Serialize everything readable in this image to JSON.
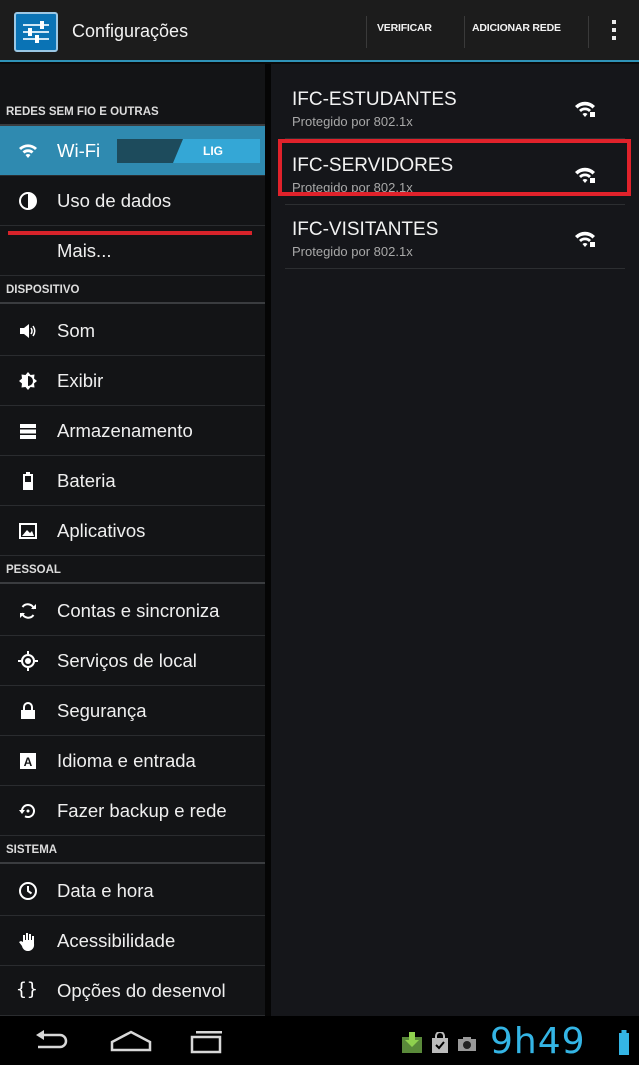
{
  "app": {
    "title": "Configurações",
    "icon": "settings-sliders-icon"
  },
  "actionbar": {
    "verify_label": "VERIFICAR",
    "add_network_label": "ADICIONAR REDE",
    "overflow_icon": "overflow-menu-icon"
  },
  "sidebar": {
    "sections": [
      {
        "header": "REDES SEM FIO E OUTRAS",
        "items": [
          {
            "label": "Wi-Fi",
            "icon": "wifi-icon",
            "active": true,
            "toggle": "LIG"
          },
          {
            "label": "Uso de dados",
            "icon": "data-usage-icon"
          },
          {
            "label": "Mais...",
            "icon": ""
          }
        ]
      },
      {
        "header": "DISPOSITIVO",
        "items": [
          {
            "label": "Som",
            "icon": "speaker-icon"
          },
          {
            "label": "Exibir",
            "icon": "brightness-icon"
          },
          {
            "label": "Armazenamento",
            "icon": "storage-icon"
          },
          {
            "label": "Bateria",
            "icon": "battery-icon"
          },
          {
            "label": "Aplicativos",
            "icon": "apps-icon"
          }
        ]
      },
      {
        "header": "PESSOAL",
        "items": [
          {
            "label": "Contas e sincroniza",
            "icon": "sync-icon"
          },
          {
            "label": "Serviços de local",
            "icon": "location-icon"
          },
          {
            "label": "Segurança",
            "icon": "lock-icon"
          },
          {
            "label": "Idioma e entrada",
            "icon": "keyboard-icon"
          },
          {
            "label": "Fazer backup e rede",
            "icon": "backup-icon"
          }
        ]
      },
      {
        "header": "SISTEMA",
        "items": [
          {
            "label": "Data e hora",
            "icon": "clock-icon"
          },
          {
            "label": "Acessibilidade",
            "icon": "hand-icon"
          },
          {
            "label": "Opções do desenvol",
            "icon": "braces-icon"
          }
        ]
      }
    ]
  },
  "networks": [
    {
      "ssid": "IFC-ESTUDANTES",
      "security": "Protegido por 802.1x",
      "icon": "wifi-locked-icon"
    },
    {
      "ssid": "IFC-SERVIDORES",
      "security": "Protegido por 802.1x",
      "icon": "wifi-locked-icon"
    },
    {
      "ssid": "IFC-VISITANTES",
      "security": "Protegido por 802.1x",
      "icon": "wifi-locked-icon"
    }
  ],
  "statusbar": {
    "time": "9h49",
    "icons": [
      "download-icon",
      "shopping-bag-icon",
      "camera-icon",
      "battery-icon"
    ]
  },
  "navbar": {
    "buttons": [
      "back-icon",
      "home-icon",
      "recent-apps-icon"
    ]
  },
  "colors": {
    "accent": "#34b5e5",
    "active_item": "#2f8ab0",
    "highlight": "#e0222b"
  }
}
